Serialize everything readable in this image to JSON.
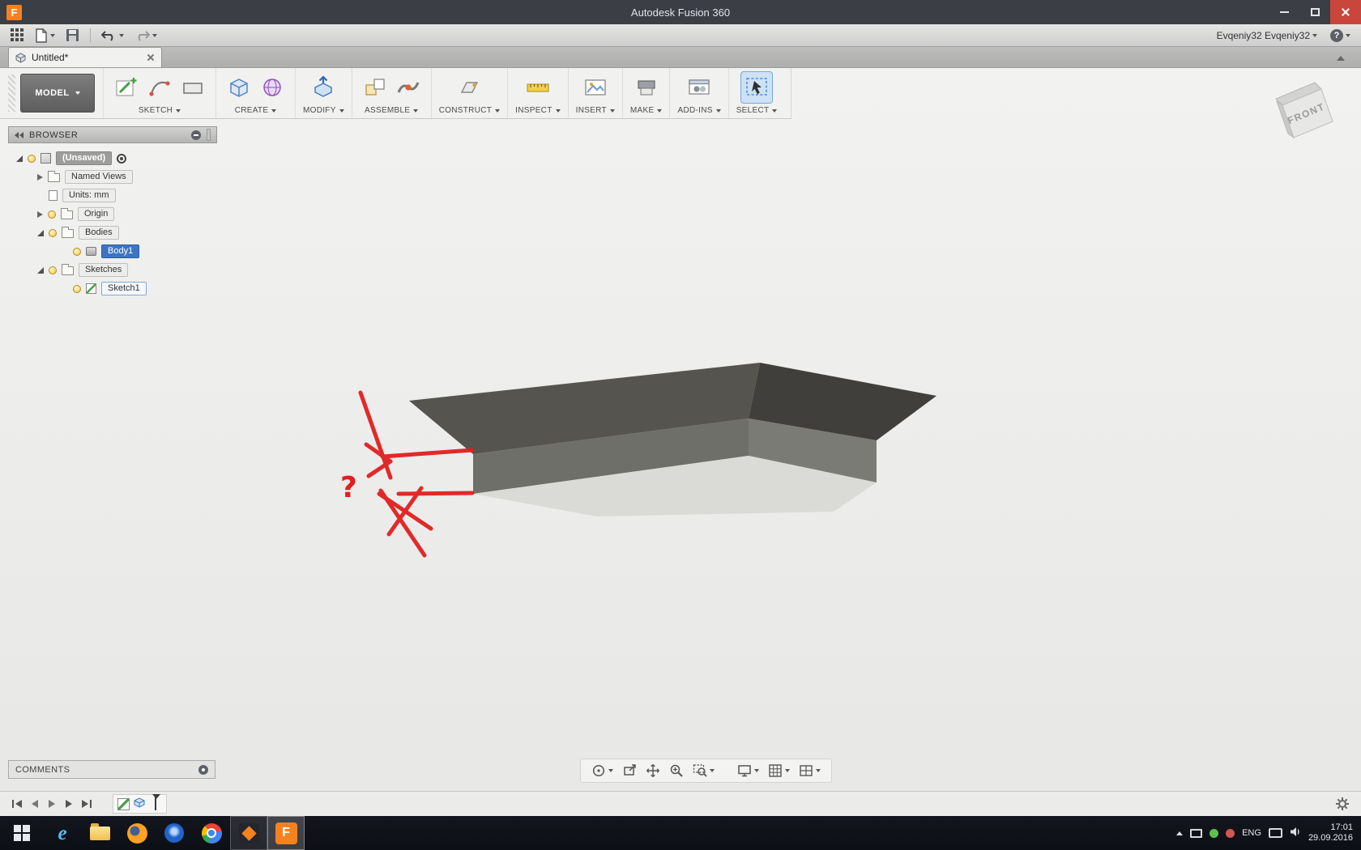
{
  "titlebar": {
    "title": "Autodesk Fusion 360",
    "logo_letter": "F"
  },
  "appbar": {
    "user": "Evqeniy32 Evqeniy32",
    "help_glyph": "?"
  },
  "tabbar": {
    "tabs": [
      {
        "label": "Untitled*"
      }
    ]
  },
  "ribbon": {
    "workspace": "MODEL",
    "groups": [
      {
        "label": "SKETCH"
      },
      {
        "label": "CREATE"
      },
      {
        "label": "MODIFY"
      },
      {
        "label": "ASSEMBLE"
      },
      {
        "label": "CONSTRUCT"
      },
      {
        "label": "INSPECT"
      },
      {
        "label": "INSERT"
      },
      {
        "label": "MAKE"
      },
      {
        "label": "ADD-INS"
      },
      {
        "label": "SELECT"
      }
    ]
  },
  "browser": {
    "title": "BROWSER",
    "tree": [
      {
        "label": "(Unsaved)"
      },
      {
        "label": "Named Views"
      },
      {
        "label": "Units: mm"
      },
      {
        "label": "Origin"
      },
      {
        "label": "Bodies"
      },
      {
        "label": "Body1"
      },
      {
        "label": "Sketches"
      },
      {
        "label": "Sketch1"
      }
    ]
  },
  "viewcube": {
    "front_label": "FRONT"
  },
  "canvas": {
    "annotation_question": "?"
  },
  "comments": {
    "label": "COMMENTS"
  },
  "taskbar": {
    "ie_glyph": "e",
    "fusion_glyph": "F",
    "lang": "ENG",
    "time": "17:01",
    "date": "29.09.2016"
  }
}
